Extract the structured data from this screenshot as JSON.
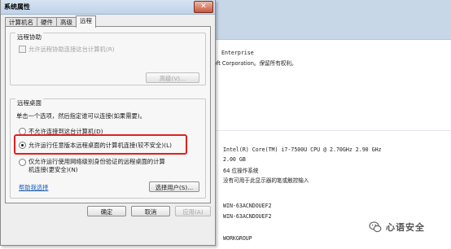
{
  "background": {
    "lines": [
      "Enterprise",
      "oft Corporation。保留所有权利。",
      "Intel(R) Core(TM) i7-7500U CPU @ 2.70GHz   2.90 GHz",
      "2.00 GB",
      "64 位操作系统",
      "没有可用于此显示器的笔或触控输入",
      "WIN-63ACNDOUEF2",
      "WIN-63ACNDOUEF2",
      "WORKGROUP"
    ]
  },
  "watermark": {
    "text": "心语安全",
    "logo": "wechat-logo"
  },
  "dialog": {
    "title": "系统属性",
    "close_label": "✕",
    "tabs": [
      "计算机名",
      "硬件",
      "高级",
      "远程"
    ],
    "active_tab": "远程",
    "remote_assistance": {
      "group_title": "远程协助",
      "allow_checkbox_label": "允许远程协助连接这台计算机(R)",
      "advanced_button": "高级(V)..."
    },
    "remote_desktop": {
      "group_title": "远程桌面",
      "instruction": "单击一个选项，然后指定谁可以连接(如果需要)。",
      "option_none": "不允许连接到这台计算机(D)",
      "option_any": "允许运行任意版本远程桌面的计算机连接(较不安全)(L)",
      "option_nla_line1": "仅允许运行使用网络级别身份验证的远程桌面的计算",
      "option_nla_line2": "机连接(更安全)(N)",
      "selected": "option_any",
      "help_link": "帮助我选择",
      "select_users_button": "选择用户(S)..."
    },
    "buttons": {
      "ok": "确定",
      "cancel": "取消",
      "apply": "应用(A)"
    },
    "highlight_color": "#e02020"
  }
}
